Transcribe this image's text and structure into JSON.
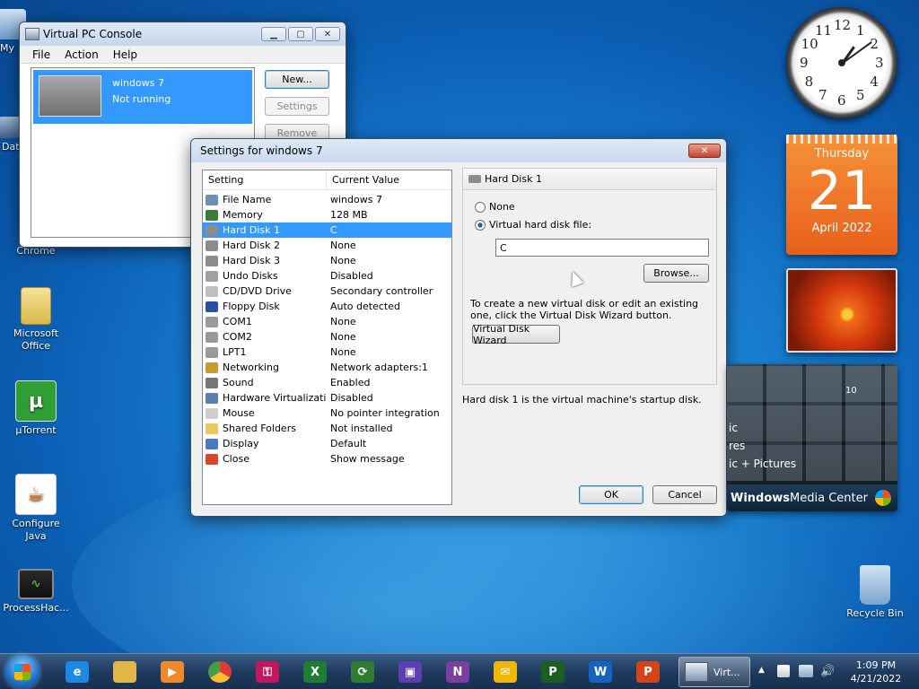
{
  "desktop": {
    "icons": [
      {
        "label": "My",
        "name": "my-computer"
      },
      {
        "label": "Dat",
        "name": "data"
      },
      {
        "label": "Chrome",
        "name": "chrome"
      },
      {
        "label": "Microsoft Office",
        "name": "microsoft-office"
      },
      {
        "label": "µTorrent",
        "name": "utorrent"
      },
      {
        "label": "Configure Java",
        "name": "configure-java"
      },
      {
        "label": "ProcessHac...",
        "name": "processhacker"
      },
      {
        "label": "Recycle Bin",
        "name": "recycle-bin"
      }
    ]
  },
  "console": {
    "title": "Virtual PC Console",
    "menu": [
      "File",
      "Action",
      "Help"
    ],
    "vm_name": "windows 7",
    "vm_status": "Not running",
    "buttons": {
      "new": "New...",
      "settings": "Settings",
      "remove": "Remove"
    }
  },
  "settings": {
    "title": "Settings for windows 7",
    "columns": {
      "setting": "Setting",
      "value": "Current Value"
    },
    "rows": [
      {
        "setting": "File Name",
        "value": "windows 7",
        "icon": "file-icon",
        "color": "#6f8fb8"
      },
      {
        "setting": "Memory",
        "value": "128 MB",
        "icon": "memory-icon",
        "color": "#3a7d3a"
      },
      {
        "setting": "Hard Disk 1",
        "value": "C",
        "icon": "hard-disk-icon",
        "color": "#8c8c8c"
      },
      {
        "setting": "Hard Disk 2",
        "value": "None",
        "icon": "hard-disk-icon",
        "color": "#8c8c8c"
      },
      {
        "setting": "Hard Disk 3",
        "value": "None",
        "icon": "hard-disk-icon",
        "color": "#8c8c8c"
      },
      {
        "setting": "Undo Disks",
        "value": "Disabled",
        "icon": "undo-disk-icon",
        "color": "#a0a0a0"
      },
      {
        "setting": "CD/DVD Drive",
        "value": "Secondary controller",
        "icon": "cd-icon",
        "color": "#bfbfbf"
      },
      {
        "setting": "Floppy Disk",
        "value": "Auto detected",
        "icon": "floppy-icon",
        "color": "#2b4fa0"
      },
      {
        "setting": "COM1",
        "value": "None",
        "icon": "com-port-icon",
        "color": "#9a9a9a"
      },
      {
        "setting": "COM2",
        "value": "None",
        "icon": "com-port-icon",
        "color": "#9a9a9a"
      },
      {
        "setting": "LPT1",
        "value": "None",
        "icon": "lpt-port-icon",
        "color": "#9a9a9a"
      },
      {
        "setting": "Networking",
        "value": "Network adapters:1",
        "icon": "network-icon",
        "color": "#c99a2e"
      },
      {
        "setting": "Sound",
        "value": "Enabled",
        "icon": "sound-icon",
        "color": "#777777"
      },
      {
        "setting": "Hardware Virtualization",
        "value": "Disabled",
        "icon": "cpu-icon",
        "color": "#5a7fae"
      },
      {
        "setting": "Mouse",
        "value": "No pointer integration",
        "icon": "mouse-icon",
        "color": "#cfcfcf"
      },
      {
        "setting": "Shared Folders",
        "value": "Not installed",
        "icon": "folder-icon",
        "color": "#e8c95a"
      },
      {
        "setting": "Display",
        "value": "Default",
        "icon": "display-icon",
        "color": "#4a78c6"
      },
      {
        "setting": "Close",
        "value": "Show message",
        "icon": "close-setting-icon",
        "color": "#d9472b"
      }
    ],
    "selected_index": 2,
    "panel": {
      "header": "Hard Disk 1",
      "radio_none": "None",
      "radio_file": "Virtual hard disk file:",
      "file_value": "C",
      "browse": "Browse...",
      "help_text": "To create a new virtual disk or edit an existing one, click the Virtual Disk Wizard button.",
      "wizard": "Virtual Disk Wizard",
      "startup_note": "Hard disk 1 is the virtual machine's startup disk."
    },
    "ok": "OK",
    "cancel": "Cancel"
  },
  "calendar": {
    "day_name": "Thursday",
    "day": "21",
    "month_year": "April 2022"
  },
  "clock_numbers": [
    "12",
    "1",
    "2",
    "3",
    "4",
    "5",
    "6",
    "7",
    "8",
    "9",
    "10",
    "11"
  ],
  "media_center": {
    "title_bold": "Windows",
    "title_rest": " Media Center",
    "menu_lines": [
      "ic",
      "res",
      "ic + Pictures"
    ],
    "tile_text": "10"
  },
  "taskbar": {
    "time": "1:09 PM",
    "date": "4/21/2022",
    "active_label": "Virt...",
    "colors": {
      "ie": "#1e88e5",
      "explorer": "#e0b84a",
      "media": "#f08a24",
      "chrome": "#e53935",
      "key": "#c2185b",
      "excel": "#1e7e34",
      "sync": "#2e7d32",
      "vpc": "#5c3fb0",
      "onenote": "#7b3fa0",
      "outlook": "#f2b705",
      "project": "#1b5e20",
      "word": "#1565c0",
      "ppt": "#d84315"
    }
  }
}
